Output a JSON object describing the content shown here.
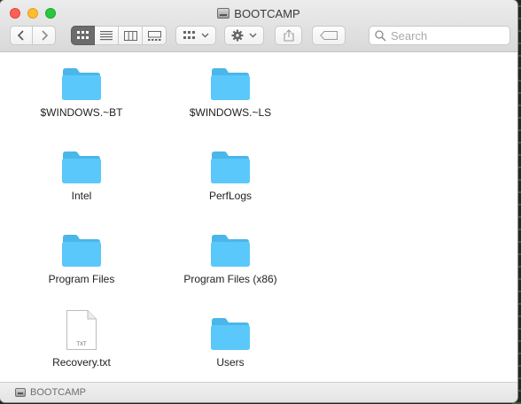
{
  "window": {
    "title": "BOOTCAMP"
  },
  "toolbar": {
    "icons": {
      "back": "chevron-left-icon",
      "forward": "chevron-right-icon",
      "view_icon": "icon-view-icon",
      "view_list": "list-view-icon",
      "view_column": "column-view-icon",
      "view_gallery": "gallery-view-icon",
      "group": "group-by-icon",
      "action": "gear-icon",
      "share": "share-icon",
      "tags": "tag-icon",
      "search": "search-icon"
    },
    "active_view": "icon",
    "search_placeholder": "Search"
  },
  "items": [
    {
      "name": "$WINDOWS.~BT",
      "kind": "folder"
    },
    {
      "name": "$WINDOWS.~LS",
      "kind": "folder"
    },
    {
      "name": "Intel",
      "kind": "folder"
    },
    {
      "name": "PerfLogs",
      "kind": "folder"
    },
    {
      "name": "Program Files",
      "kind": "folder"
    },
    {
      "name": "Program Files (x86)",
      "kind": "folder"
    },
    {
      "name": "Recovery.txt",
      "kind": "document",
      "badge": "TXT"
    },
    {
      "name": "Users",
      "kind": "folder"
    }
  ],
  "statusbar": {
    "path_label": "BOOTCAMP"
  },
  "colors": {
    "folder": "#5ac8fa",
    "folder_tab": "#4ab6ea",
    "close": "#fe5f57",
    "minimize": "#febc2e",
    "zoom": "#28c840"
  }
}
